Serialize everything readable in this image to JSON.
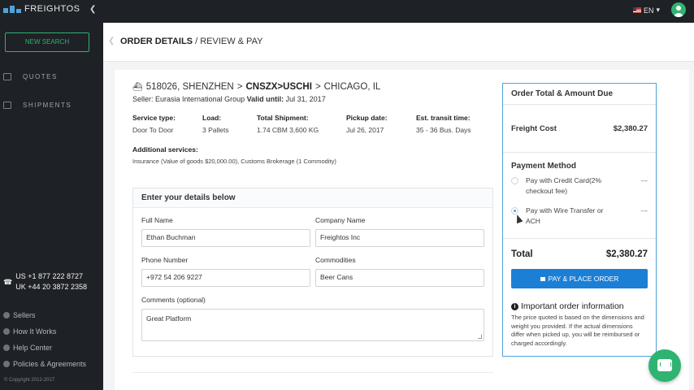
{
  "sidebar": {
    "brand": "FREIGHTOS",
    "new_search": "NEW SEARCH",
    "nav": [
      {
        "label": "QUOTES",
        "icon": "list-icon"
      },
      {
        "label": "SHIPMENTS",
        "icon": "truck-icon"
      }
    ],
    "phones": [
      "US +1 877 222 8727",
      "UK +44 20 3872 2358"
    ],
    "links": [
      "Sellers",
      "How It Works",
      "Help Center",
      "Policies & Agreements"
    ],
    "copyright": "© Copyright 2012-2017"
  },
  "topbar": {
    "lang": "EN"
  },
  "header": {
    "title": "ORDER DETAILS",
    "subtitle": " / REVIEW & PAY"
  },
  "route": {
    "id_origin": "518026, SHENZHEN",
    "code": "CNSZX>USCHI",
    "destination": "CHICAGO, IL",
    "sep": ">",
    "seller_label": "Seller:",
    "seller": "Eurasia International Group",
    "valid_label": "Valid until:",
    "valid": "Jul 31, 2017"
  },
  "details": [
    {
      "label": "Service type:",
      "value": "Door To Door"
    },
    {
      "label": "Load:",
      "value": "3 Pallets"
    },
    {
      "label": "Total Shipment:",
      "value": "1.74 CBM 3,600 KG"
    },
    {
      "label": "Pickup date:",
      "value": "Jul 26, 2017"
    },
    {
      "label": "Est. transit time:",
      "value": "35 - 36 Bus. Days"
    }
  ],
  "additional": {
    "label": "Additional services:",
    "value": "Insurance (Value of goods $20,000.00), Customs Brokerage (1 Commodity)"
  },
  "form": {
    "title": "Enter your details below",
    "full_name_label": "Full Name",
    "full_name": "Ethan Buchman",
    "company_label": "Company Name",
    "company": "Freightos Inc",
    "phone_label": "Phone Number",
    "phone": "+972 54 206 9227",
    "commodities_label": "Commodities",
    "commodities": "Beer Cans",
    "comments_label": "Comments (optional)",
    "comments": "Great Platform"
  },
  "order": {
    "title": "Order Total & Amount Due",
    "freight_label": "Freight Cost",
    "freight_value": "$2,380.27",
    "payment_title": "Payment Method",
    "options": [
      {
        "label": "Pay with Credit Card(2% checkout fee)",
        "fee": "---",
        "selected": false
      },
      {
        "label": "Pay with Wire Transfer or ACH",
        "fee": "---",
        "selected": true
      }
    ],
    "total_label": "Total",
    "total_value": "$2,380.27",
    "pay_button": "PAY & PLACE ORDER",
    "info_title": "Important order information",
    "info_text": "The price quoted is based on the dimensions and weight you provided. If the actual dimensions differ when picked up, you will be reimbursed or charged accordingly."
  },
  "colors": {
    "accent": "#1c7fd6",
    "brand_green": "#2fb371",
    "sidebar": "#1e2126"
  }
}
